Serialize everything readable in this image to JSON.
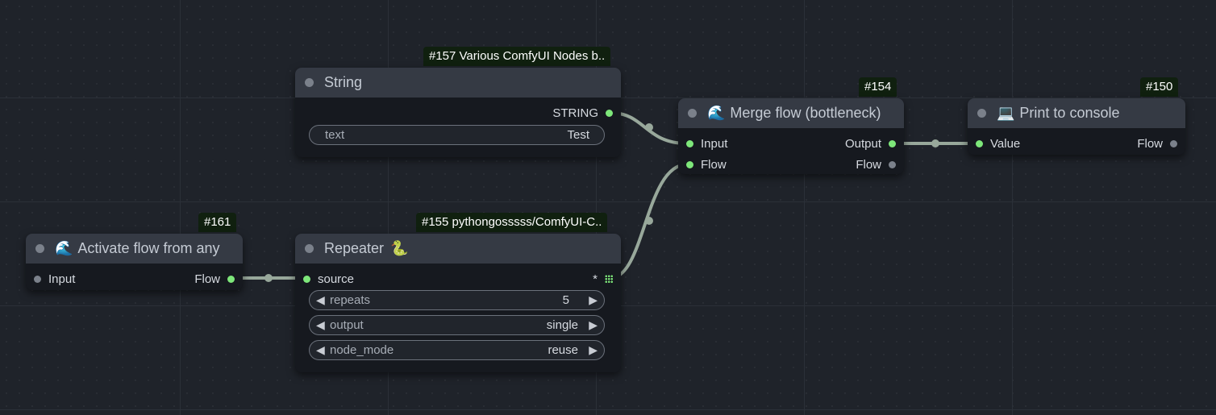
{
  "nodes": {
    "string": {
      "badge": "#157 Various ComfyUI Nodes b..",
      "title": "String",
      "output_label": "STRING",
      "widget": {
        "label": "text",
        "value": "Test"
      }
    },
    "merge": {
      "badge": "#154",
      "icon": "🌊",
      "title": "Merge flow (bottleneck)",
      "inputs": [
        "Input",
        "Flow"
      ],
      "outputs": [
        "Output",
        "Flow"
      ]
    },
    "print": {
      "badge": "#150",
      "icon": "💻",
      "title": "Print to console",
      "input_label": "Value",
      "output_label": "Flow"
    },
    "activate": {
      "badge": "#161",
      "icon": "🌊",
      "title": "Activate flow from any",
      "input_label": "Input",
      "output_label": "Flow"
    },
    "repeater": {
      "badge": "#155 pythongosssss/ComfyUI-C..",
      "title": "Repeater",
      "icon": "🐍",
      "input_label": "source",
      "output_label": "*",
      "widgets": [
        {
          "label": "repeats",
          "value": "5"
        },
        {
          "label": "output",
          "value": "single"
        },
        {
          "label": "node_mode",
          "value": "reuse"
        }
      ],
      "arrow_left": "◀",
      "arrow_right": "▶"
    }
  },
  "colors": {
    "background": "#1f232a",
    "node_body": "#16191f",
    "node_header": "#353a44",
    "connected_slot": "#7ee77a",
    "link": "#98a89b",
    "badge_bg": "#10200f"
  }
}
